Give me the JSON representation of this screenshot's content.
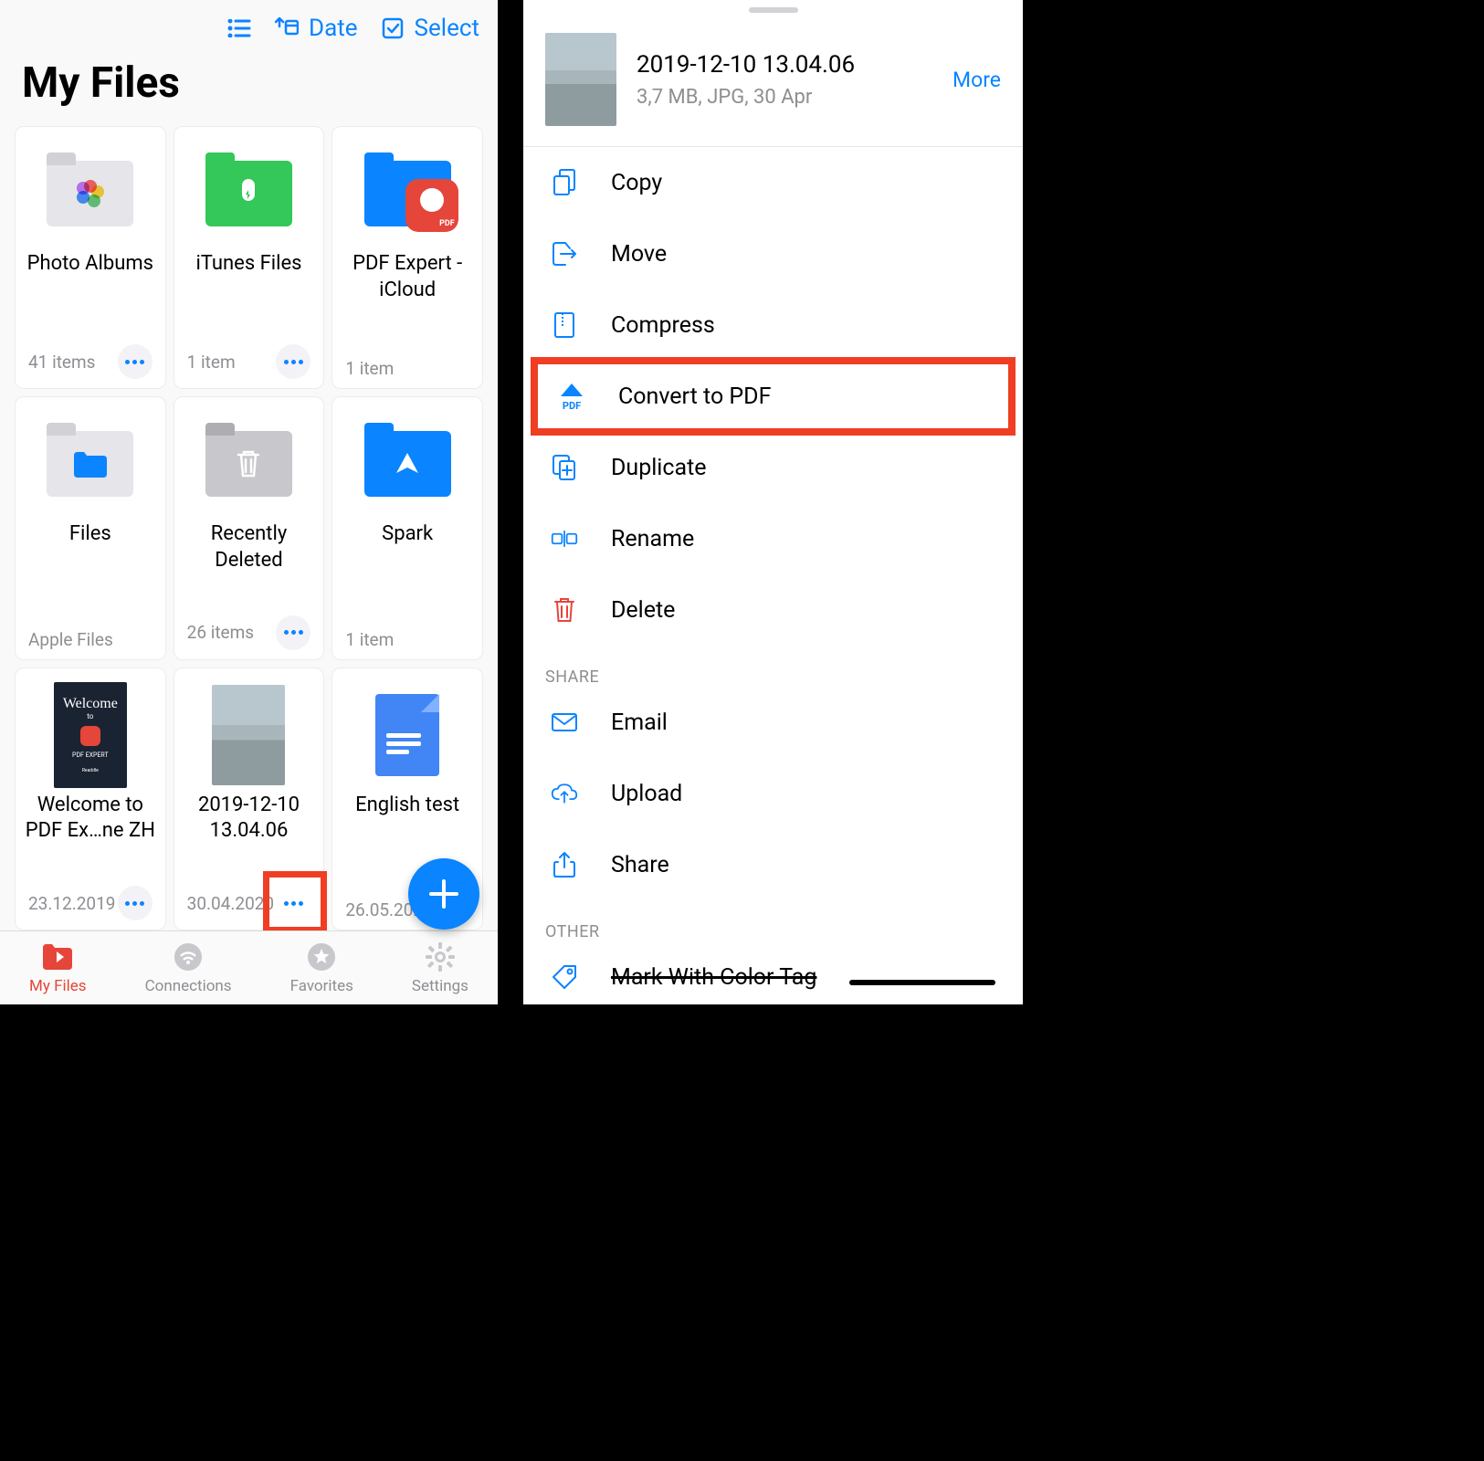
{
  "left": {
    "toolbar": {
      "date": "Date",
      "select": "Select"
    },
    "title": "My Files",
    "items": [
      {
        "name": "Photo Albums",
        "sub": "41 items"
      },
      {
        "name": "iTunes Files",
        "sub": "1 item"
      },
      {
        "name": "PDF Expert - iCloud",
        "sub": "1 item"
      },
      {
        "name": "Files",
        "sub": "Apple Files"
      },
      {
        "name": "Recently Deleted",
        "sub": "26 items"
      },
      {
        "name": "Spark",
        "sub": "1 item"
      },
      {
        "name": "Welcome to PDF Ex…ne ZH",
        "sub": "23.12.2019"
      },
      {
        "name": "2019-12-10 13.04.06",
        "sub": "30.04.2020"
      },
      {
        "name": "English test",
        "sub": "26.05.202"
      }
    ],
    "nav": {
      "myfiles": "My Files",
      "connections": "Connections",
      "favorites": "Favorites",
      "settings": "Settings"
    }
  },
  "right": {
    "file": {
      "title": "2019-12-10 13.04.06",
      "sub": "3,7 MB, JPG, 30 Apr",
      "more": "More"
    },
    "actions": {
      "copy": "Copy",
      "move": "Move",
      "compress": "Compress",
      "convert": "Convert to PDF",
      "duplicate": "Duplicate",
      "rename": "Rename",
      "delete": "Delete"
    },
    "share_label": "SHARE",
    "share": {
      "email": "Email",
      "upload": "Upload",
      "share": "Share"
    },
    "other_label": "OTHER",
    "other": {
      "tag": "Mark With Color Tag"
    }
  }
}
